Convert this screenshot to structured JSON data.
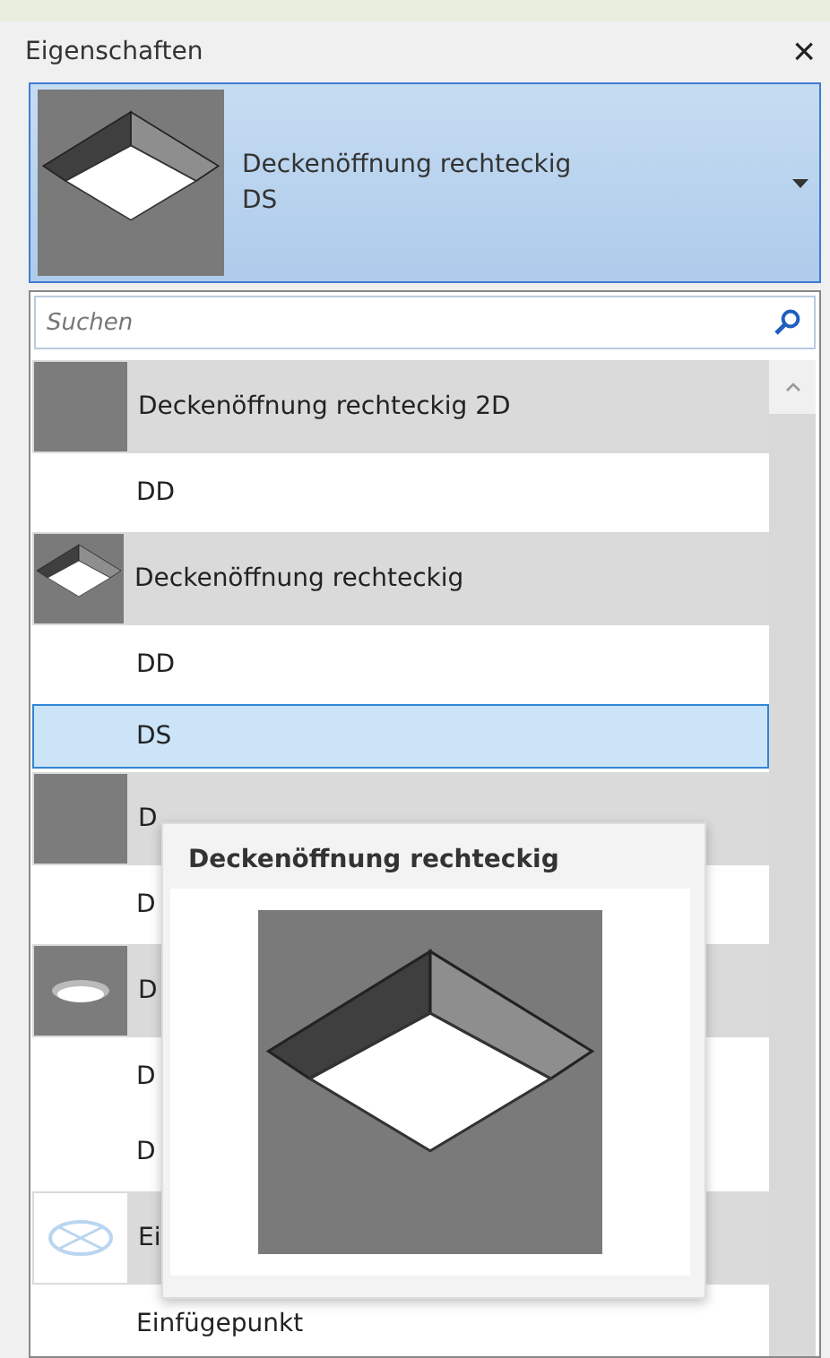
{
  "panel": {
    "title": "Eigenschaften",
    "close": "×"
  },
  "type_selector": {
    "family": "Deckenöffnung rechteckig",
    "type": "DS"
  },
  "search": {
    "placeholder": "Suchen"
  },
  "items": [
    {
      "kind": "blank",
      "label": "Deckenöffnung rechteckig 2D",
      "selected": false
    },
    {
      "kind": "type",
      "label": "DD",
      "selected": false
    },
    {
      "kind": "square",
      "label": "Deckenöffnung rechteckig",
      "selected": false
    },
    {
      "kind": "type",
      "label": "DD",
      "selected": false
    },
    {
      "kind": "type",
      "label": "DS",
      "selected": true
    },
    {
      "kind": "blank",
      "label": "D",
      "selected": false
    },
    {
      "kind": "type",
      "label": "D",
      "selected": false
    },
    {
      "kind": "round",
      "label": "D",
      "selected": false
    },
    {
      "kind": "type",
      "label": "D",
      "selected": false
    },
    {
      "kind": "type",
      "label": "D",
      "selected": false
    },
    {
      "kind": "point",
      "label": "Ei",
      "selected": false
    },
    {
      "kind": "type",
      "label": "Einfügepunkt",
      "selected": false
    }
  ],
  "tooltip": {
    "title": "Deckenöffnung rechteckig"
  }
}
